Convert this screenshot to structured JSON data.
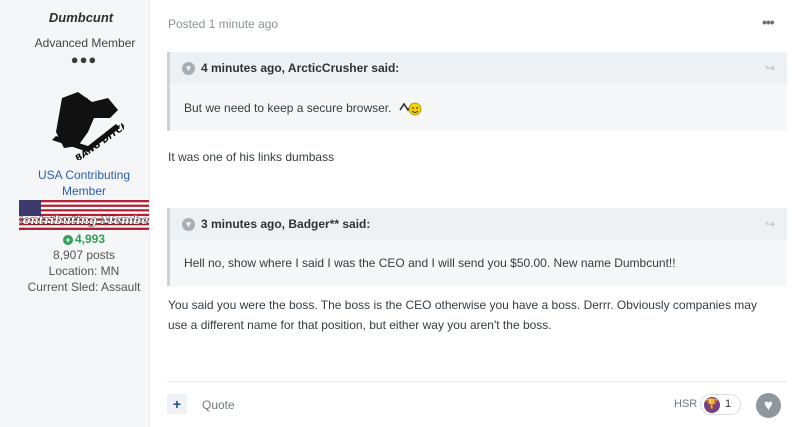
{
  "author": {
    "name": "Dumbcunt",
    "rank": "Advanced Member",
    "rank_pips": "●●●",
    "group_line1": "USA Contributing",
    "group_line2": "Member",
    "badge_text": "Contributing Member",
    "reputation": "4,993",
    "posts": "8,907 posts",
    "location": "Location: MN",
    "sled": "Current Sled: Assault",
    "avatar_text": "BANG DITCHES"
  },
  "post": {
    "posted": "Posted 1 minute ago",
    "more_menu": "•••",
    "quote1": {
      "header": "4 minutes ago, ArcticCrusher said:",
      "body": "But we need to keep a secure browser."
    },
    "reply1": "It was one of his links dumbass",
    "quote2": {
      "header": "3 minutes ago, Badger** said:",
      "body": "Hell no, show where I said I was the CEO and I will send you $50.00. New name Dumbcunt!!"
    },
    "reply2_line1": "You said you were the boss.  The boss is the CEO otherwise you have a boss.  Derrr.  Obviously companies may",
    "reply2_line2": "use a different name for that position, but either way you aren't the boss."
  },
  "footer": {
    "add_label": "+",
    "quote_label": "Quote",
    "reaction_user": "HSR",
    "reaction_count": "1"
  },
  "colors": {
    "link_blue": "#2b5db2",
    "rep_green": "#2f9e55",
    "reaction_purple": "#7a3e86"
  }
}
